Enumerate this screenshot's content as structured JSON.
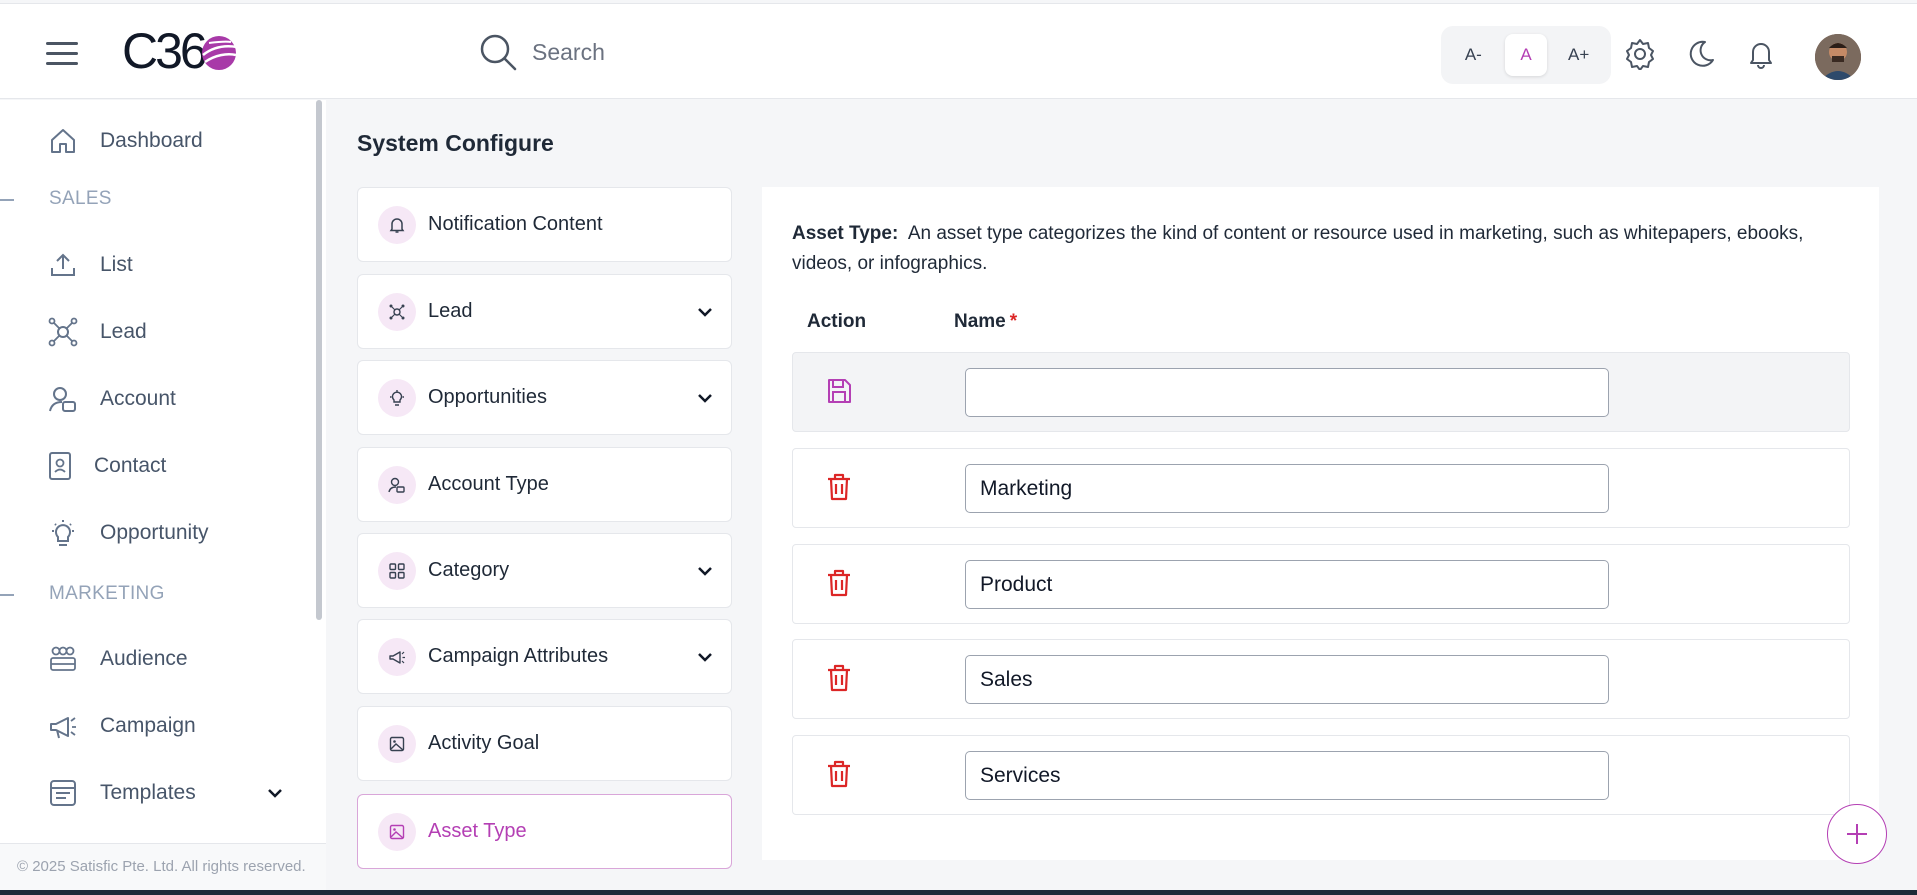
{
  "header": {
    "logo_text": "C36",
    "search_placeholder": "Search",
    "font_controls": [
      "A-",
      "A",
      "A+"
    ]
  },
  "sidebar": {
    "items": [
      {
        "label": "Dashboard",
        "icon": "home-icon"
      },
      {
        "label": "List",
        "icon": "upload-icon"
      },
      {
        "label": "Lead",
        "icon": "network-icon"
      },
      {
        "label": "Account",
        "icon": "user-card-icon"
      },
      {
        "label": "Contact",
        "icon": "contact-card-icon"
      },
      {
        "label": "Opportunity",
        "icon": "lightbulb-icon"
      },
      {
        "label": "Audience",
        "icon": "group-icon"
      },
      {
        "label": "Campaign",
        "icon": "megaphone-icon"
      },
      {
        "label": "Templates",
        "icon": "template-icon"
      }
    ],
    "sections": [
      "SALES",
      "MARKETING"
    ],
    "copyright": "© 2025 Satisfic Pte. Ltd. All rights reserved."
  },
  "main": {
    "title": "System Configure",
    "config_items": [
      {
        "label": "Notification Content",
        "expandable": false
      },
      {
        "label": "Lead",
        "expandable": true
      },
      {
        "label": "Opportunities",
        "expandable": true
      },
      {
        "label": "Account Type",
        "expandable": false
      },
      {
        "label": "Category",
        "expandable": true
      },
      {
        "label": "Campaign Attributes",
        "expandable": true
      },
      {
        "label": "Activity Goal",
        "expandable": false
      },
      {
        "label": "Asset Type",
        "expandable": false,
        "active": true
      }
    ],
    "panel": {
      "desc_title": "Asset Type:",
      "desc_text": "An asset type categorizes the kind of content or resource used in marketing, such as whitepapers, ebooks, videos, or infographics.",
      "col_action": "Action",
      "col_name": "Name",
      "required_mark": "*",
      "rows": [
        "",
        "Marketing",
        "Product",
        "Sales",
        "Services"
      ]
    }
  },
  "colors": {
    "accent": "#b43fb4",
    "danger": "#dc2626"
  }
}
